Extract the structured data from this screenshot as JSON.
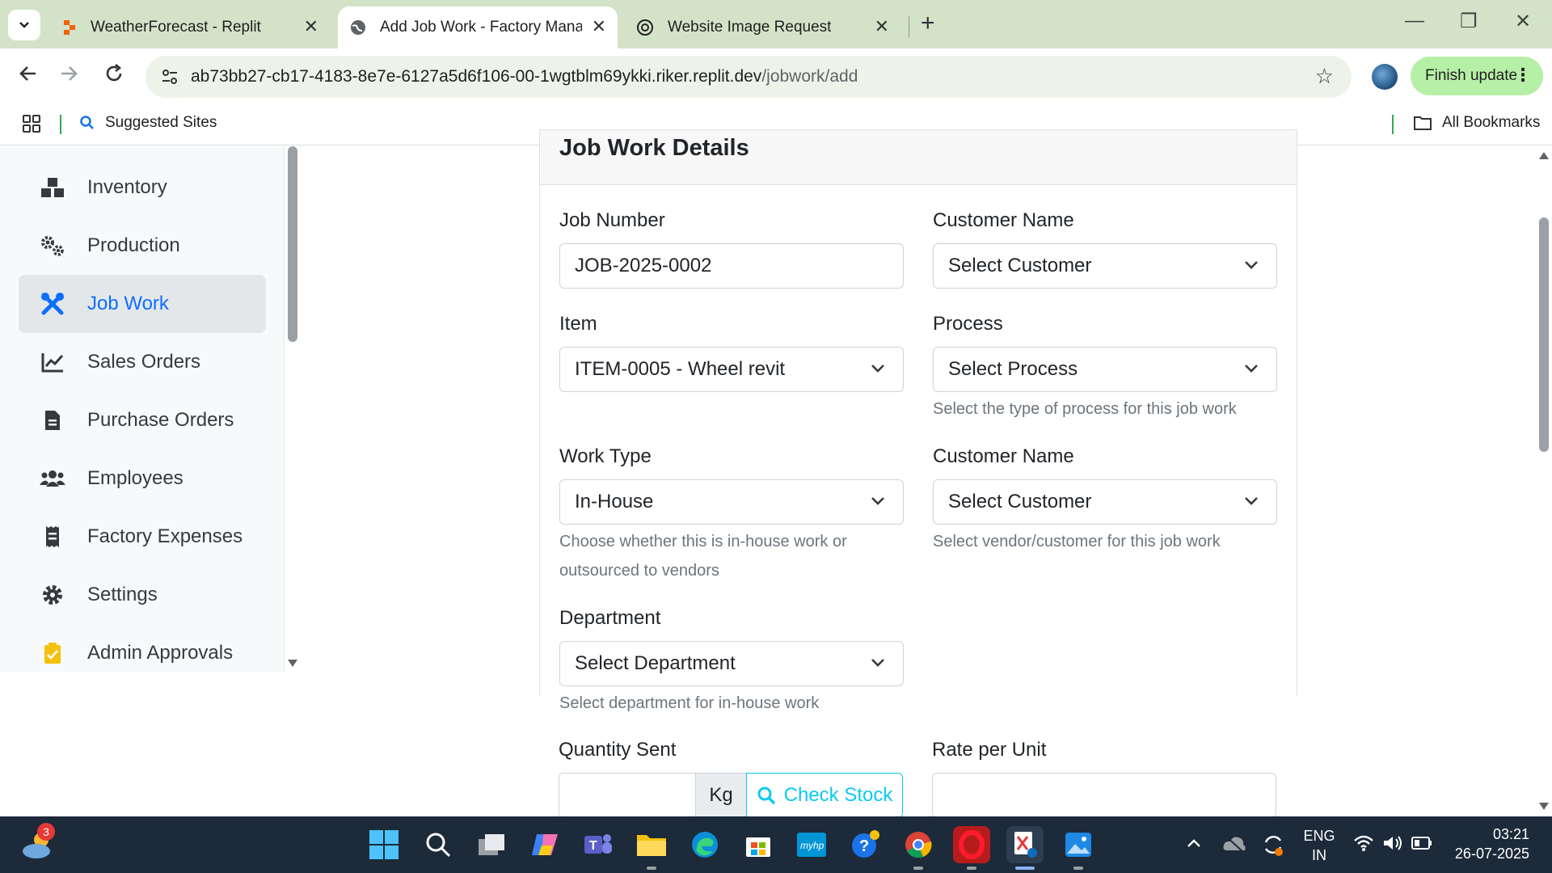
{
  "browser": {
    "tabs": [
      {
        "title": "WeatherForecast - Replit"
      },
      {
        "title": "Add Job Work - Factory Manage"
      },
      {
        "title": "Website Image Request"
      }
    ],
    "url_host": "ab73bb27-cb17-4183-8e7e-6127a5d6f106-00-1wgtblm69ykki.riker.replit.dev",
    "url_path": "/jobwork/add",
    "finish_update": "Finish update",
    "bookmarks": {
      "suggested": "Suggested Sites",
      "all": "All Bookmarks"
    }
  },
  "sidebar": {
    "items": [
      {
        "label": "Inventory",
        "icon": "boxes-icon"
      },
      {
        "label": "Production",
        "icon": "cogs-icon"
      },
      {
        "label": "Job Work",
        "icon": "tools-icon",
        "active": true
      },
      {
        "label": "Sales Orders",
        "icon": "chart-line-icon"
      },
      {
        "label": "Purchase Orders",
        "icon": "file-invoice-icon"
      },
      {
        "label": "Employees",
        "icon": "users-icon"
      },
      {
        "label": "Factory Expenses",
        "icon": "receipt-icon"
      },
      {
        "label": "Settings",
        "icon": "gear-icon"
      },
      {
        "label": "Admin Approvals",
        "icon": "clipboard-check-icon"
      }
    ]
  },
  "form": {
    "title": "Job Work Details",
    "job_number": {
      "label": "Job Number",
      "value": "JOB-2025-0002"
    },
    "customer_name": {
      "label": "Customer Name",
      "value": "Select Customer"
    },
    "item": {
      "label": "Item",
      "value": "ITEM-0005 - Wheel revit"
    },
    "process": {
      "label": "Process",
      "value": "Select Process",
      "help": "Select the type of process for this job work"
    },
    "work_type": {
      "label": "Work Type",
      "value": "In-House",
      "help_line1": "Choose whether this is in-house work or",
      "help_line2": "outsourced to vendors"
    },
    "customer_name_2": {
      "label": "Customer Name",
      "value": "Select Customer",
      "help": "Select vendor/customer for this job work"
    },
    "department": {
      "label": "Department",
      "value": "Select Department",
      "help": "Select department for in-house work"
    },
    "quantity_sent": {
      "label": "Quantity Sent",
      "value": "",
      "unit": "Kg",
      "check_stock": "Check Stock"
    },
    "rate_per_unit": {
      "label": "Rate per Unit",
      "value": ""
    }
  },
  "taskbar": {
    "weather_badge": "3",
    "lang_line1": "ENG",
    "lang_line2": "IN",
    "time": "03:21",
    "date": "26-07-2025"
  },
  "colors": {
    "accent": "#0d6efd",
    "info": "#0dcaf0",
    "tabbar": "#d3e3c8",
    "finish_update": "#b6f0a6"
  }
}
